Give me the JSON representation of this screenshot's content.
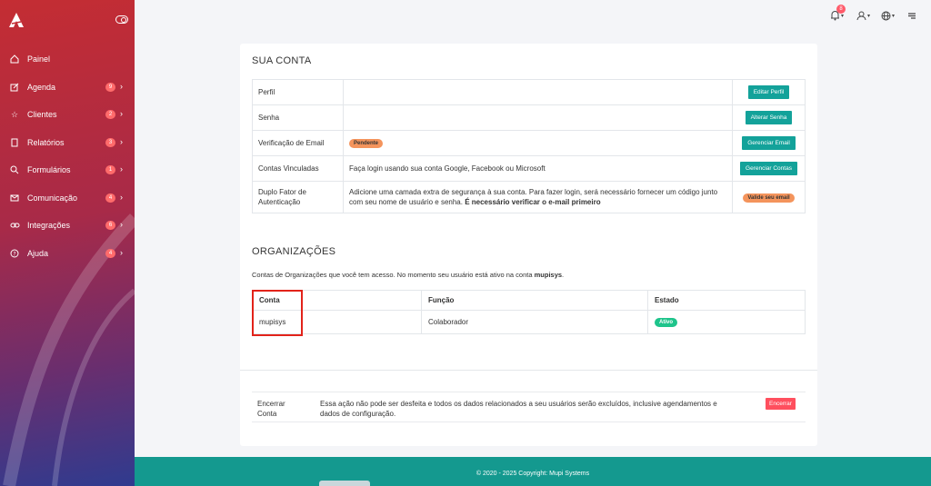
{
  "sidebar": {
    "items": [
      {
        "label": "Painel",
        "badge": ""
      },
      {
        "label": "Agenda",
        "badge": "9"
      },
      {
        "label": "Clientes",
        "badge": "2"
      },
      {
        "label": "Relatórios",
        "badge": "3"
      },
      {
        "label": "Formulários",
        "badge": "1"
      },
      {
        "label": "Comunicação",
        "badge": "4"
      },
      {
        "label": "Integrações",
        "badge": "6"
      },
      {
        "label": "Ajuda",
        "badge": "4"
      }
    ]
  },
  "topbar": {
    "notification_count": "8"
  },
  "account": {
    "title": "SUA CONTA",
    "rows": [
      {
        "label": "Perfil",
        "desc": "",
        "action": "Editar Perfil"
      },
      {
        "label": "Senha",
        "desc": "",
        "action": "Alterar Senha"
      },
      {
        "label": "Verificação de Email",
        "status": "Pendente",
        "action": "Gerenciar Email"
      },
      {
        "label": "Contas Vinculadas",
        "desc": "Faça login usando sua conta Google, Facebook ou Microsoft",
        "action": "Gerenciar Contas"
      },
      {
        "label": "Duplo Fator de Autenticação",
        "desc": "Adicione uma camada extra de segurança à sua conta. Para fazer login, será necessário fornecer um código junto com seu nome de usuário e senha.",
        "desc_bold": "É necessário verificar o e-mail primeiro",
        "action": "Valide seu email"
      }
    ]
  },
  "organizations": {
    "title": "ORGANIZAÇÕES",
    "desc": "Contas de Organizações que você tem acesso. No momento seu usuário está ativo na conta",
    "active_account": "mupisys",
    "columns": [
      "Conta",
      "Função",
      "Estado"
    ],
    "rows": [
      {
        "conta": "mupisys",
        "funcao": "Colaborador",
        "estado": "Ativo"
      }
    ]
  },
  "close_account": {
    "label": "Encerrar Conta",
    "text": "Essa ação não pode ser desfeita e todos os dados relacionados a seu usuários serão excluídos, inclusive agendamentos e dados de configuração.",
    "button": "Encerrar"
  },
  "footer": {
    "copyright": "© 2020 - 2025 Copyright:",
    "company": "Mupi Systems"
  },
  "colors": {
    "accent": "#13a29a",
    "danger": "#ff4f5e",
    "pending": "#f4945c",
    "success": "#1ec48b"
  }
}
